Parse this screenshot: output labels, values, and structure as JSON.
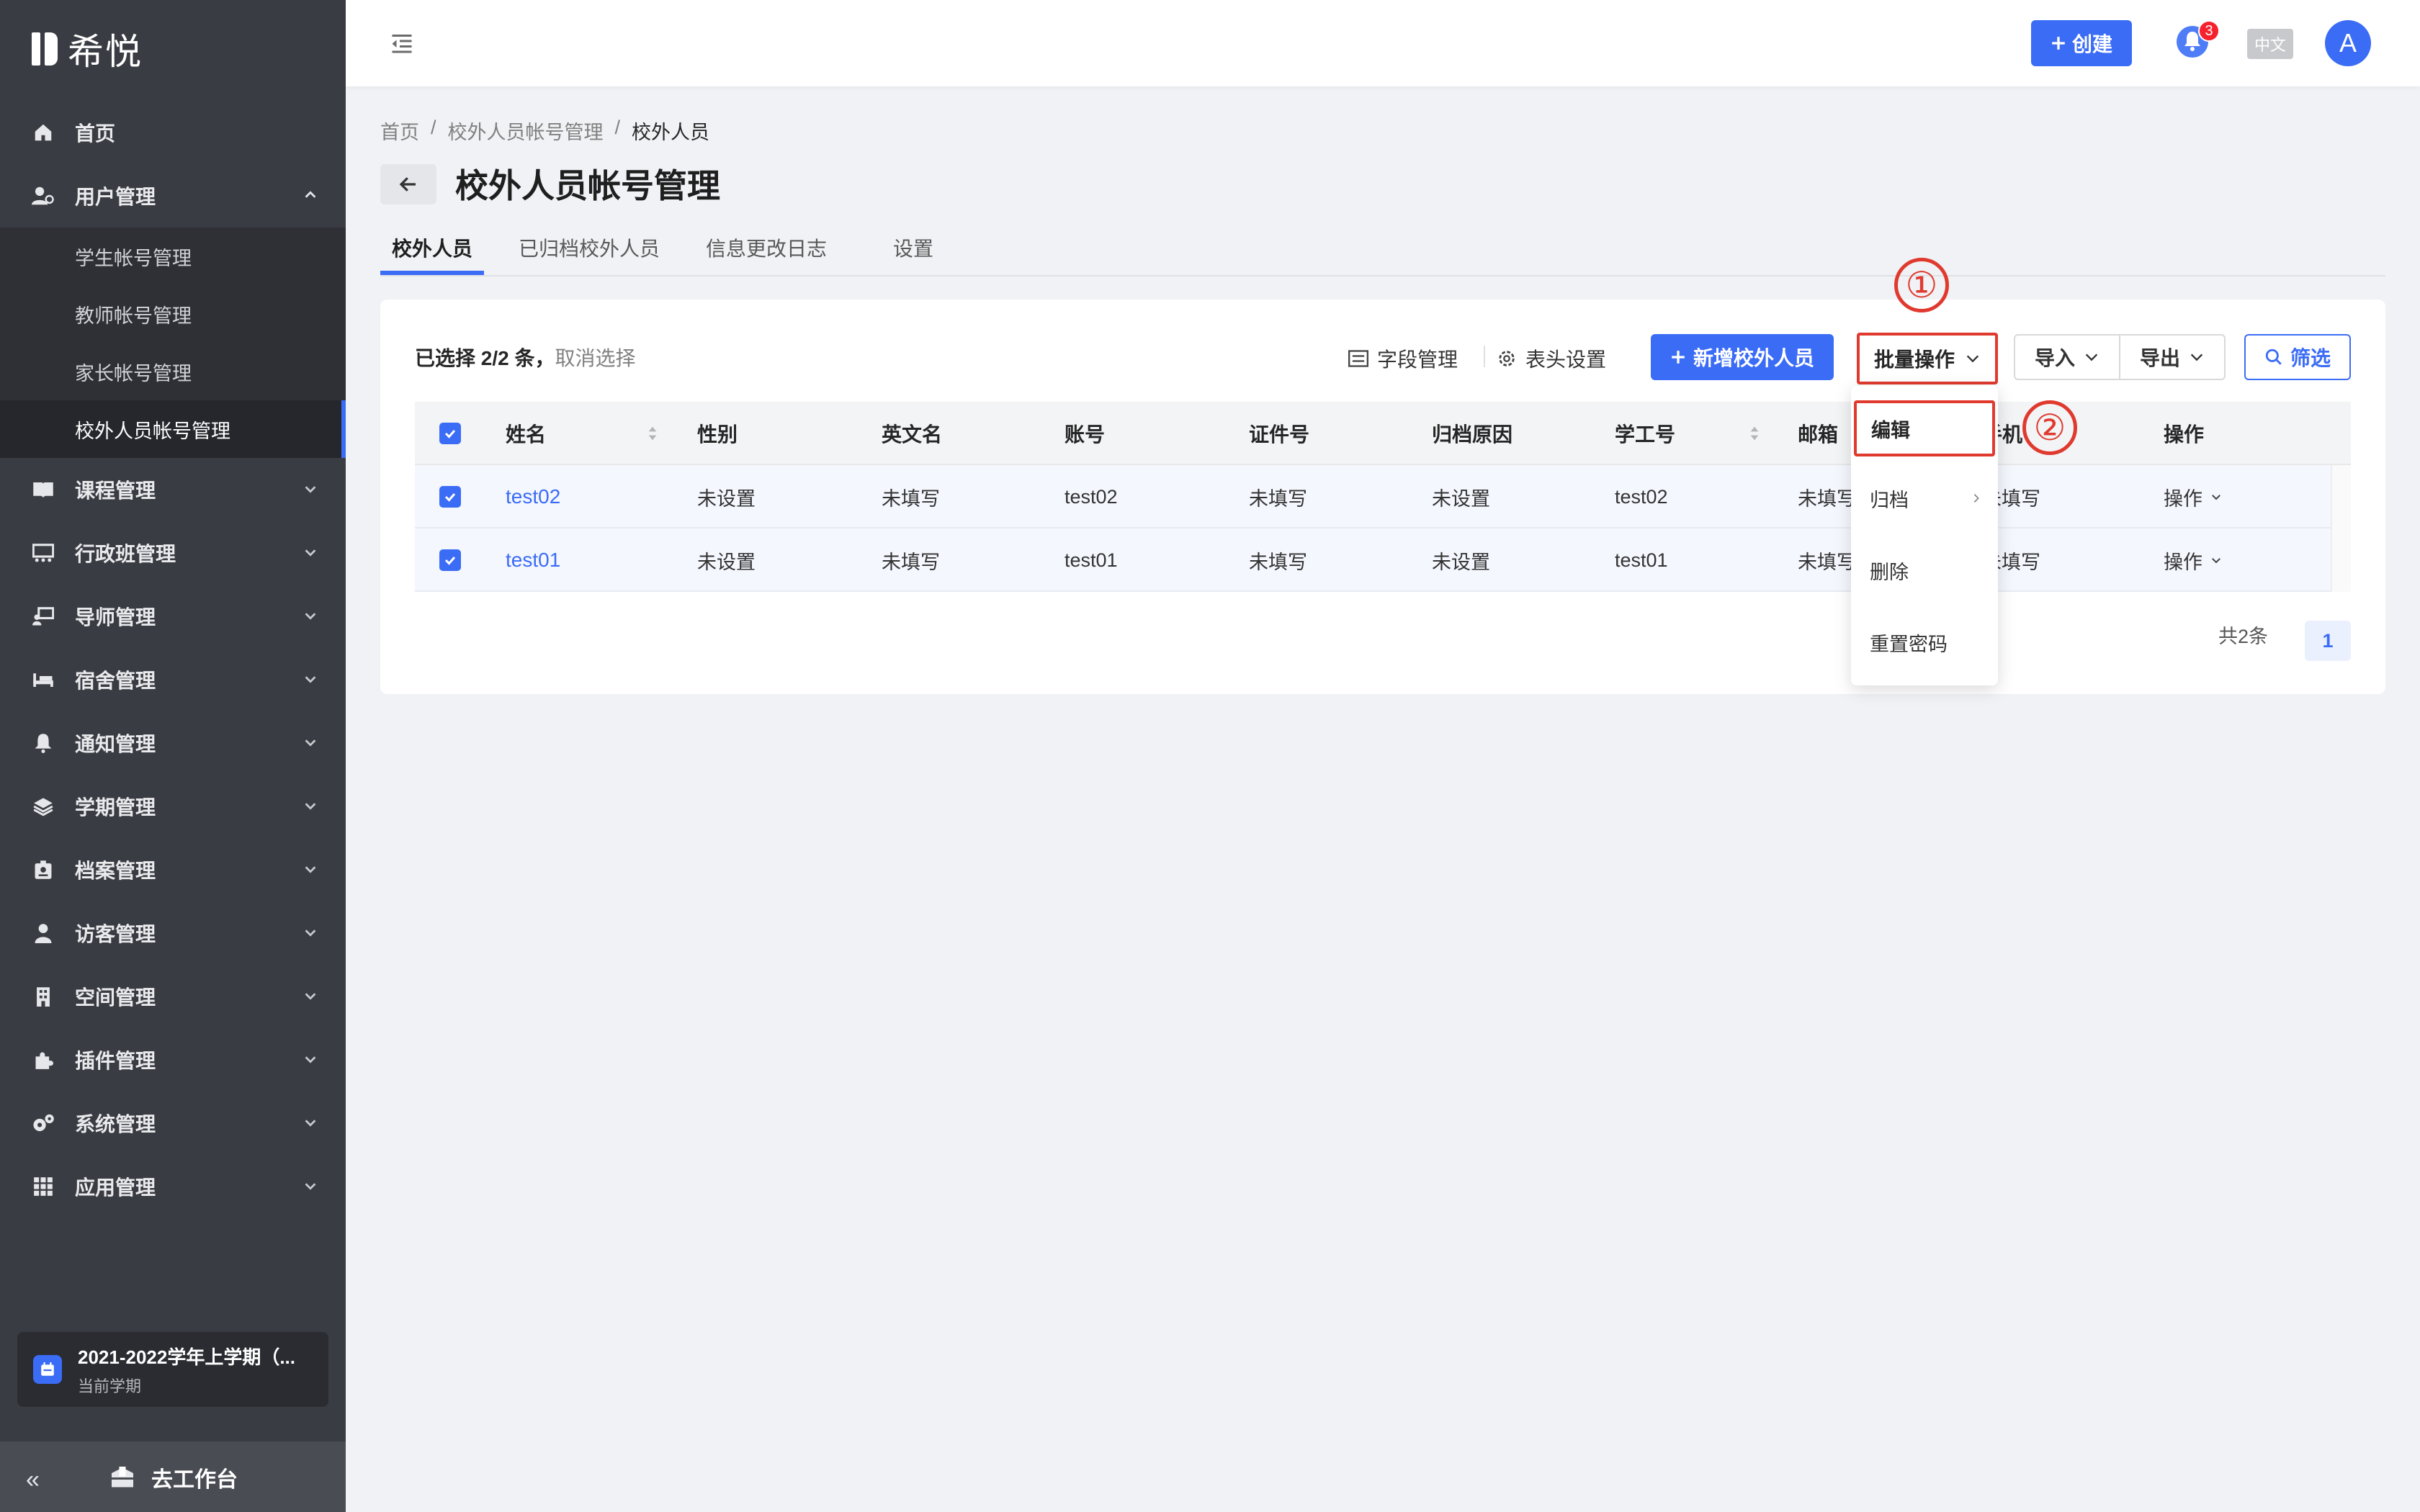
{
  "app": {
    "logo_text": "希悦"
  },
  "sidebar": {
    "items": [
      {
        "label": "首页",
        "icon": "home-icon"
      },
      {
        "label": "用户管理",
        "icon": "users-icon",
        "expanded": true,
        "children": [
          "学生帐号管理",
          "教师帐号管理",
          "家长帐号管理",
          "校外人员帐号管理"
        ]
      },
      {
        "label": "课程管理",
        "icon": "book-icon"
      },
      {
        "label": "行政班管理",
        "icon": "class-icon"
      },
      {
        "label": "导师管理",
        "icon": "mentor-icon"
      },
      {
        "label": "宿舍管理",
        "icon": "bed-icon"
      },
      {
        "label": "通知管理",
        "icon": "bell-icon"
      },
      {
        "label": "学期管理",
        "icon": "layers-icon"
      },
      {
        "label": "档案管理",
        "icon": "badge-icon"
      },
      {
        "label": "访客管理",
        "icon": "visitor-icon"
      },
      {
        "label": "空间管理",
        "icon": "building-icon"
      },
      {
        "label": "插件管理",
        "icon": "puzzle-icon"
      },
      {
        "label": "系统管理",
        "icon": "gears-icon"
      },
      {
        "label": "应用管理",
        "icon": "grid-icon"
      }
    ],
    "active_child": "校外人员帐号管理",
    "term": {
      "title": "2021-2022学年上学期（...",
      "subtitle": "当前学期"
    },
    "footer": {
      "collapse": "«",
      "workbench": "去工作台"
    }
  },
  "header": {
    "create_label": "创建",
    "notification_count": "3",
    "language": "中文",
    "avatar_letter": "A"
  },
  "breadcrumb": [
    "首页",
    "/",
    "校外人员帐号管理",
    "/",
    "校外人员"
  ],
  "page_title": "校外人员帐号管理",
  "tabs": [
    "校外人员",
    "已归档校外人员",
    "信息更改日志",
    "设置"
  ],
  "toolbar": {
    "selected_text": "已选择 2/2 条，",
    "clear_selection": "取消选择",
    "field_manage": "字段管理",
    "header_settings": "表头设置",
    "add_button": "新增校外人员",
    "batch_button": "批量操作",
    "import": "导入",
    "export": "导出",
    "filter": "筛选"
  },
  "table": {
    "columns": [
      "姓名",
      "性别",
      "英文名",
      "账号",
      "证件号",
      "归档原因",
      "学工号",
      "邮箱",
      "手机",
      "操作"
    ],
    "rows": [
      {
        "name": "test02",
        "gender": "未设置",
        "english": "未填写",
        "account": "test02",
        "id_no": "未填写",
        "archive_reason": "未设置",
        "staff_no": "test02",
        "email": "未填写",
        "phone": "未填写",
        "action": "操作"
      },
      {
        "name": "test01",
        "gender": "未设置",
        "english": "未填写",
        "account": "test01",
        "id_no": "未填写",
        "archive_reason": "未设置",
        "staff_no": "test01",
        "email": "未填写",
        "phone": "未填写",
        "action": "操作"
      }
    ]
  },
  "pagination": {
    "total": "共2条",
    "current": "1"
  },
  "dropdown": {
    "items": [
      "编辑",
      "归档",
      "删除",
      "重置密码"
    ]
  },
  "annotations": {
    "step1": "①",
    "step2": "②"
  },
  "colors": {
    "primary": "#3b6cf6",
    "sidebar": "#3a3c43",
    "highlight": "#e03a2f"
  }
}
